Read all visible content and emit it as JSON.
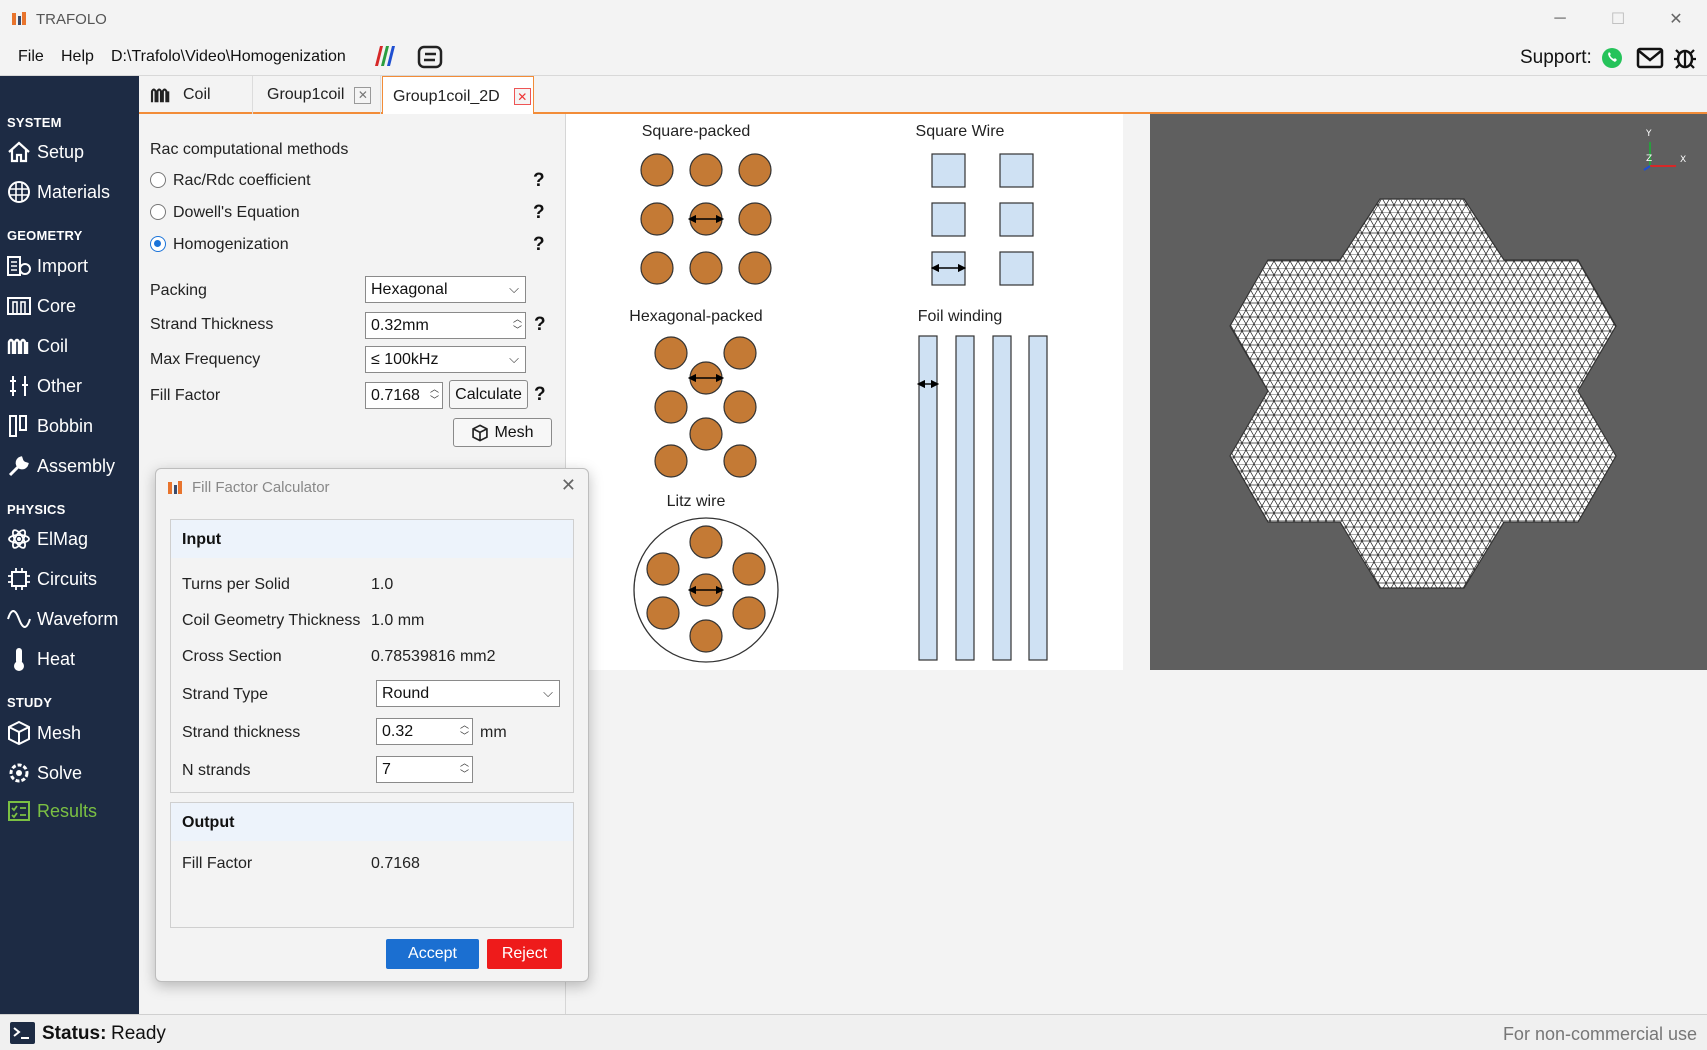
{
  "titlebar": {
    "app_name": "TRAFOLO",
    "minimize": "─",
    "maximize": "☐",
    "close": "✕"
  },
  "menubar": {
    "file": "File",
    "help": "Help",
    "project_path": "D:\\Trafolo\\Video\\Homogenization",
    "support_label": "Support:"
  },
  "sidebar": {
    "sections": {
      "system": "SYSTEM",
      "geometry": "GEOMETRY",
      "physics": "PHYSICS",
      "study": "STUDY"
    },
    "items": {
      "setup": "Setup",
      "materials": "Materials",
      "import": "Import",
      "core": "Core",
      "coil": "Coil",
      "other": "Other",
      "bobbin": "Bobbin",
      "assembly": "Assembly",
      "elmag": "ElMag",
      "circuits": "Circuits",
      "waveform": "Waveform",
      "heat": "Heat",
      "mesh": "Mesh",
      "solve": "Solve",
      "results": "Results"
    }
  },
  "tabs": [
    {
      "label": "Coil"
    },
    {
      "label": "Group1coil"
    },
    {
      "label": "Group1coil_2D"
    }
  ],
  "panel": {
    "methods_title": "Rac computational methods",
    "methods": [
      "Rac/Rdc coefficient",
      "Dowell's Equation",
      "Homogenization"
    ],
    "selected_method": "Homogenization",
    "help_glyph": "?",
    "packing_label": "Packing",
    "packing_value": "Hexagonal",
    "strand_thickness_label": "Strand Thickness",
    "strand_thickness_value": "0.32mm",
    "max_freq_label": "Max Frequency",
    "max_freq_value": "≤ 100kHz",
    "fill_factor_label": "Fill Factor",
    "fill_factor_value": "0.7168",
    "calculate_button": "Calculate",
    "mesh_button": "Mesh"
  },
  "diagram": {
    "square_packed": "Square-packed",
    "square_wire": "Square Wire",
    "hexagonal_packed": "Hexagonal-packed",
    "foil_winding": "Foil winding",
    "litz_wire": "Litz wire"
  },
  "viewport": {
    "axis_y": "Y",
    "axis_x": "X",
    "axis_z": "Z"
  },
  "dialog": {
    "title": "Fill Factor Calculator",
    "close": "✕",
    "input_header": "Input",
    "turns_label": "Turns per Solid",
    "turns_value": "1.0",
    "coil_thick_label": "Coil Geometry Thickness",
    "coil_thick_value": "1.0 mm",
    "cross_label": "Cross Section",
    "cross_value": "0.78539816 mm2",
    "strand_type_label": "Strand Type",
    "strand_type_value": "Round",
    "strand_thick_label": "Strand thickness",
    "strand_thick_value": "0.32",
    "strand_thick_unit": "mm",
    "n_strands_label": "N strands",
    "n_strands_value": "7",
    "output_header": "Output",
    "fill_label": "Fill Factor",
    "fill_value": "0.7168",
    "accept": "Accept",
    "reject": "Reject"
  },
  "status": {
    "label": "Status:",
    "value": "Ready",
    "license": "For non-commercial use"
  },
  "colors": {
    "sidebar": "#1d2b44",
    "accent": "#f28c38",
    "accept": "#1b6fd1",
    "reject": "#ee1b1b",
    "strand": "#c47a35",
    "wire": "#cfe1f3",
    "results": "#7bc043"
  }
}
